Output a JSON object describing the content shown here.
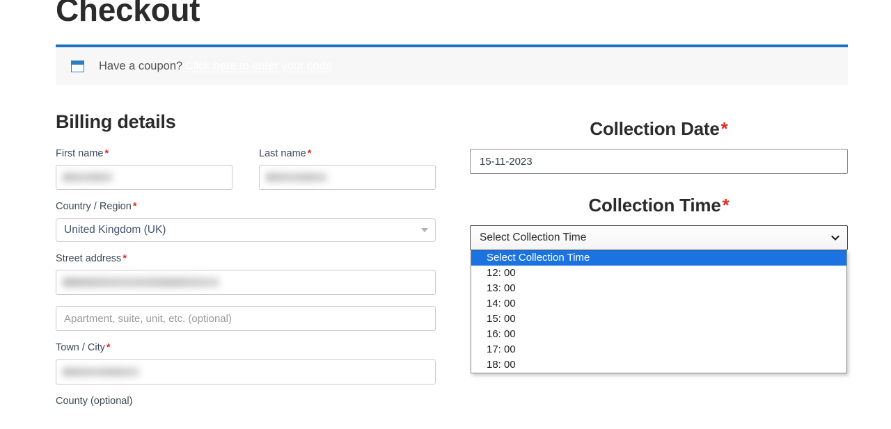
{
  "page": {
    "title": "Checkout"
  },
  "coupon": {
    "icon": "coupon-ticket-icon",
    "prompt": "Have a coupon?",
    "link_label": "Click here to enter your code"
  },
  "billing": {
    "heading": "Billing details",
    "required_mark": "*",
    "fields": {
      "first_name": {
        "label": "First name",
        "required": true,
        "value": "",
        "redacted": true
      },
      "last_name": {
        "label": "Last name",
        "required": true,
        "value": "",
        "redacted": true
      },
      "country": {
        "label": "Country / Region",
        "required": true,
        "value": "United Kingdom (UK)",
        "icon": "chevron-down-icon"
      },
      "street_address": {
        "label": "Street address",
        "required": true,
        "value": "",
        "redacted": true
      },
      "address_line_2": {
        "label": "",
        "required": false,
        "value": "",
        "placeholder": "Apartment, suite, unit, etc. (optional)"
      },
      "town_city": {
        "label": "Town / City",
        "required": true,
        "value": "",
        "redacted": true
      },
      "county": {
        "label": "County (optional)",
        "required": false,
        "value": ""
      }
    }
  },
  "collection": {
    "date": {
      "heading": "Collection Date",
      "required_mark": "*",
      "value": "15-11-2023"
    },
    "time": {
      "heading": "Collection Time",
      "required_mark": "*",
      "selected_label": "Select Collection Time",
      "expanded": true,
      "icon": "chevron-down-icon",
      "options": [
        {
          "label": "Select Collection Time",
          "selected": true
        },
        {
          "label": "12: 00",
          "selected": false
        },
        {
          "label": "13: 00",
          "selected": false
        },
        {
          "label": "14: 00",
          "selected": false
        },
        {
          "label": "15: 00",
          "selected": false
        },
        {
          "label": "16: 00",
          "selected": false
        },
        {
          "label": "17: 00",
          "selected": false
        },
        {
          "label": "18: 00",
          "selected": false
        }
      ]
    }
  },
  "colors": {
    "accent_blue": "#1e73be",
    "highlight_blue": "#1a73e0",
    "required_red": "#e02b20",
    "notice_bg": "#f7f7f7",
    "text_dark": "#2b2b2b",
    "label_text": "#3c4858"
  }
}
